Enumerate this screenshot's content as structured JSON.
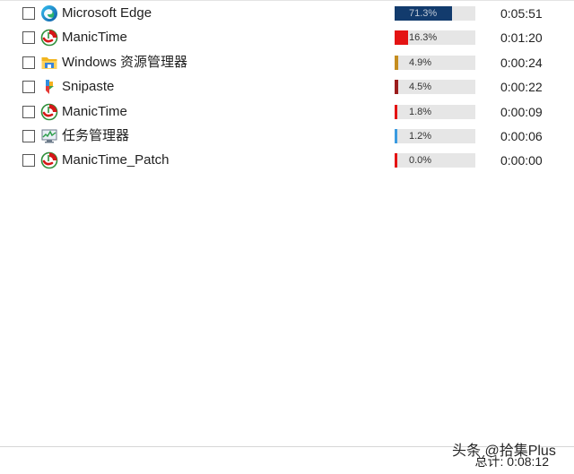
{
  "rows": [
    {
      "app": "Microsoft Edge",
      "icon": "edge-icon",
      "percent": 71.3,
      "percent_label": "71.3%",
      "duration": "0:05:51",
      "bar_color": "#123b6d"
    },
    {
      "app": "ManicTime",
      "icon": "manictime-icon",
      "percent": 16.3,
      "percent_label": "16.3%",
      "duration": "0:01:20",
      "bar_color": "#e41313"
    },
    {
      "app": "Windows 资源管理器",
      "icon": "folder-icon",
      "percent": 4.9,
      "percent_label": "4.9%",
      "duration": "0:00:24",
      "bar_color": "#c58d1f"
    },
    {
      "app": "Snipaste",
      "icon": "snipaste-icon",
      "percent": 4.5,
      "percent_label": "4.5%",
      "duration": "0:00:22",
      "bar_color": "#9b1c1c"
    },
    {
      "app": "ManicTime",
      "icon": "manictime-icon",
      "percent": 1.8,
      "percent_label": "1.8%",
      "duration": "0:00:09",
      "bar_color": "#e41313"
    },
    {
      "app": "任务管理器",
      "icon": "task-manager-icon",
      "percent": 1.2,
      "percent_label": "1.2%",
      "duration": "0:00:06",
      "bar_color": "#3b9be0"
    },
    {
      "app": "ManicTime_Patch",
      "icon": "manictime-icon",
      "percent": 0.0,
      "percent_label": "0.0%",
      "duration": "0:00:00",
      "bar_color": "#e41313"
    }
  ],
  "footer": {
    "total": "总计: 0:08:12",
    "watermark": "头条 @拾集Plus"
  },
  "colors": {
    "track": "#e6e6e6"
  }
}
